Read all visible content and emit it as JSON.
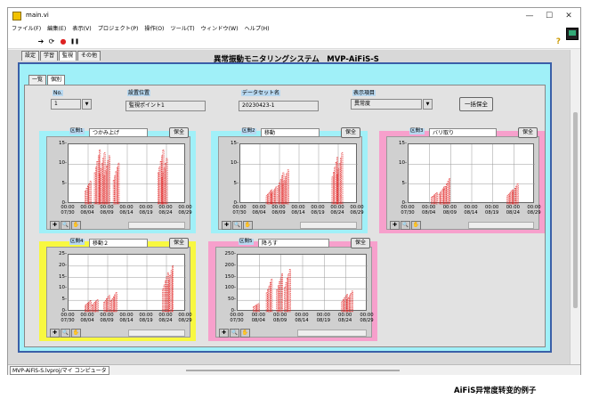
{
  "window": {
    "title": "main.vi",
    "min": "—",
    "max": "☐",
    "close": "✕"
  },
  "menu": [
    "ファイル(F)",
    "編集(E)",
    "表示(V)",
    "プロジェクト(P)",
    "操作(O)",
    "ツール(T)",
    "ウィンドウ(W)",
    "ヘルプ(H)"
  ],
  "toolbar": {
    "run": "➔",
    "run_cont": "⟳",
    "abort": "●",
    "pause": "❚❚",
    "help": "?"
  },
  "tabs": [
    "設定",
    "学習",
    "監視",
    "その他"
  ],
  "active_tab": "監視",
  "subtabs": [
    "一覧",
    "個別"
  ],
  "active_subtab": "個別",
  "main_title": "異常振動モニタリングシステム　MVP-AiFiS-S",
  "controls": {
    "no_label": "No.",
    "no_value": "1",
    "location_label": "設置位置",
    "location_value": "監視ポイント1",
    "dataset_label": "データセット名",
    "dataset_value": "20230423-1",
    "display_label": "表示項目",
    "display_value": "異常度",
    "save_all_button": "一括保全"
  },
  "charts": [
    {
      "section_label": "区間1",
      "name": "つかみ上げ",
      "save": "保全",
      "bg": "#a0f0f8",
      "yticks": [
        "15-",
        "10-",
        "5-",
        "0-"
      ],
      "ymax": 15
    },
    {
      "section_label": "区間2",
      "name": "移動",
      "save": "保全",
      "bg": "#a0f0f8",
      "yticks": [
        "15-",
        "10-",
        "5-",
        "0-"
      ],
      "ymax": 15
    },
    {
      "section_label": "区間3",
      "name": "バリ取り",
      "save": "保全",
      "bg": "#f7a0cc",
      "yticks": [
        "15-",
        "10-",
        "5-",
        "0-"
      ],
      "ymax": 15
    },
    {
      "section_label": "区間4",
      "name": "移動２",
      "save": "保全",
      "bg": "#f8f840",
      "yticks": [
        "25-",
        "20-",
        "15-",
        "10-",
        "5-",
        "0-"
      ],
      "ymax": 25
    },
    {
      "section_label": "区間5",
      "name": "降ろす",
      "save": "保全",
      "bg": "#f7a0cc",
      "yticks": [
        "250-",
        "200-",
        "150-",
        "100-",
        "50-",
        "0-"
      ],
      "ymax": 250
    }
  ],
  "xticks_time": [
    "00:00",
    "00:00",
    "00:00",
    "00:00",
    "00:00",
    "00:00",
    "00:00"
  ],
  "xticks_date": [
    "07/30",
    "08/04",
    "08/09",
    "08/14",
    "08/19",
    "08/24",
    "08/29"
  ],
  "status_path": "MVP-AiFiS-S.lvproj/マイ コンピュータ",
  "caption": "AiFiS异常度转变的例子",
  "colors": {
    "accent_blue": "#3a5fa8",
    "cyan": "#a0f0f8",
    "pink": "#f7a0cc",
    "yellow": "#f8f840",
    "data_red": "#e02020"
  }
}
